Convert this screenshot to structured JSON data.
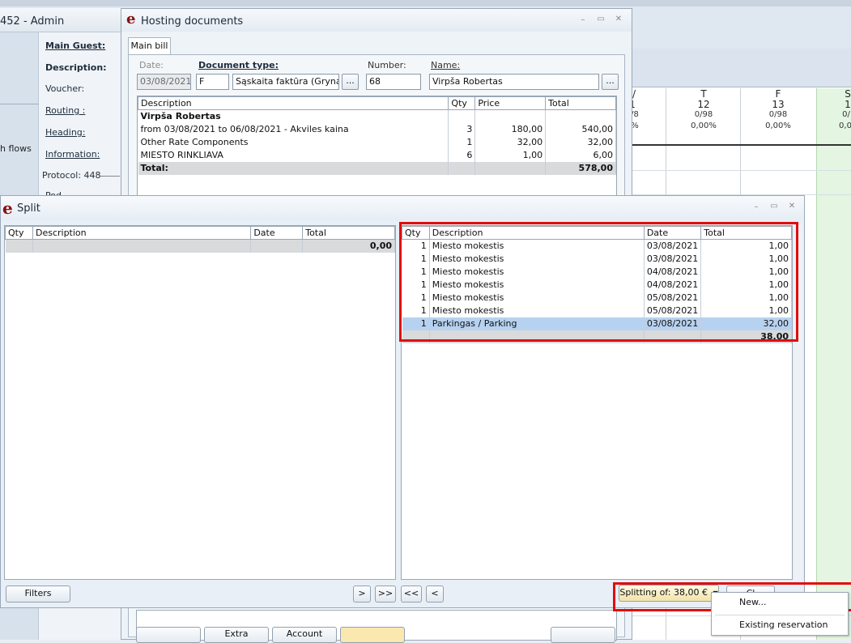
{
  "admin": {
    "title": "452 - Admin",
    "flows_label": "h flows",
    "form_labels": {
      "main_guest": "Main Guest:",
      "description": "Description:",
      "voucher": "Voucher:",
      "routing": "Routing :",
      "heading": "Heading:",
      "information": "Information:",
      "protocol": "Protocol: 448",
      "partial": "Pod"
    }
  },
  "planner": {
    "columns": [
      {
        "day": "T",
        "date": "12",
        "rooms": "0/98",
        "pct": "0,00%"
      },
      {
        "day": "F",
        "date": "13",
        "rooms": "0/98",
        "pct": "0,00%"
      }
    ],
    "partial_left": {
      "day": "/",
      "date": "1",
      "rooms": "/8",
      "pct": "%"
    },
    "partial_right": {
      "day": "S",
      "date": "1",
      "rooms": "0/",
      "pct": "0,0"
    }
  },
  "hosting": {
    "title": "Hosting documents",
    "tab": "Main bill",
    "labels": {
      "date": "Date:",
      "doc_type": "Document type:",
      "number": "Number:",
      "name": "Name:"
    },
    "values": {
      "date": "03/08/2021",
      "doc_code": "F",
      "doc_type": "Sąskaita faktūra (Grynais pinigais)",
      "number": "68",
      "name": "Virpša Robertas"
    },
    "dots": "...",
    "columns": [
      "Description",
      "Qty",
      "Price",
      "Total"
    ],
    "rows": [
      {
        "desc": "Virpša Robertas",
        "qty": "",
        "price": "",
        "total": "",
        "bold": true
      },
      {
        "desc": "from 03/08/2021 to 06/08/2021 - Akviles kaina",
        "qty": "3",
        "price": "180,00",
        "total": "540,00"
      },
      {
        "desc": "Other Rate Components",
        "qty": "1",
        "price": "32,00",
        "total": "32,00"
      },
      {
        "desc": "MIESTO RINKLIAVA",
        "qty": "6",
        "price": "1,00",
        "total": "6,00"
      }
    ],
    "total_label": "Total:",
    "total_value": "578,00",
    "bottom_buttons": [
      "Extra",
      "Account"
    ]
  },
  "split": {
    "title": "Split",
    "left": {
      "columns": [
        "Qty",
        "Description",
        "Date",
        "Total"
      ],
      "total": "0,00"
    },
    "right": {
      "columns": [
        "Qty",
        "Description",
        "Date",
        "Total"
      ],
      "rows": [
        {
          "qty": "1",
          "desc": "Miesto mokestis",
          "date": "03/08/2021",
          "total": "1,00"
        },
        {
          "qty": "1",
          "desc": "Miesto mokestis",
          "date": "03/08/2021",
          "total": "1,00"
        },
        {
          "qty": "1",
          "desc": "Miesto mokestis",
          "date": "04/08/2021",
          "total": "1,00"
        },
        {
          "qty": "1",
          "desc": "Miesto mokestis",
          "date": "04/08/2021",
          "total": "1,00"
        },
        {
          "qty": "1",
          "desc": "Miesto mokestis",
          "date": "05/08/2021",
          "total": "1,00"
        },
        {
          "qty": "1",
          "desc": "Miesto mokestis",
          "date": "05/08/2021",
          "total": "1,00"
        },
        {
          "qty": "1",
          "desc": "Parkingas / Parking",
          "date": "03/08/2021",
          "total": "32,00",
          "selected": true
        }
      ],
      "total": "38,00"
    },
    "buttons": {
      "filters": "Filters",
      "move_right": ">",
      "move_all_right": ">>",
      "move_all_left": "<<",
      "move_left": "<",
      "splitting": "Splitting of: 38,00 €",
      "close_partial": "Cl"
    }
  },
  "context_menu": {
    "items": [
      "New...",
      "Existing reservation"
    ]
  },
  "colors": {
    "highlight_red": "#e20d0d",
    "selection_blue": "#b7d2f0",
    "brand_e": "#8a1010"
  }
}
